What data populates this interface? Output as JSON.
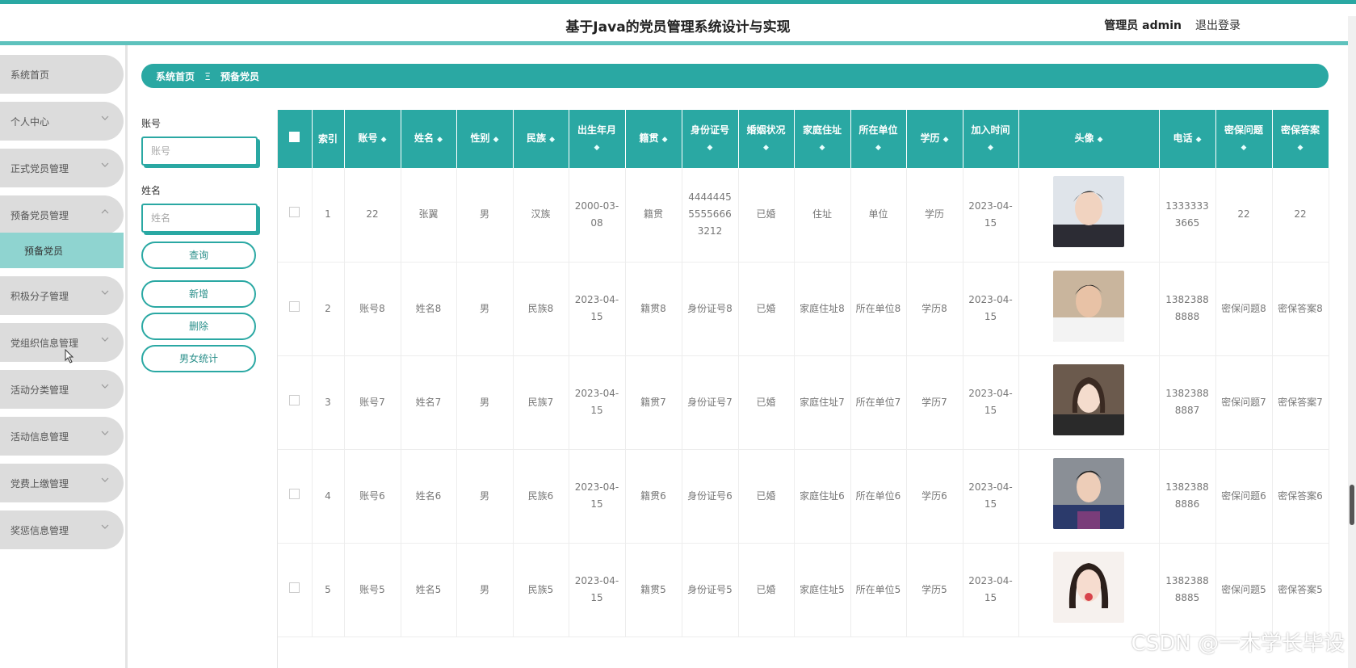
{
  "header": {
    "title": "基于Java的党员管理系统设计与实现",
    "admin": "管理员 admin",
    "logout": "退出登录"
  },
  "sidebar": {
    "items": [
      {
        "label": "系统首页",
        "has_chevron": false
      },
      {
        "label": "个人中心",
        "has_chevron": true
      },
      {
        "label": "正式党员管理",
        "has_chevron": true
      },
      {
        "label": "预备党员管理",
        "has_chevron": true
      },
      {
        "label": "积极分子管理",
        "has_chevron": true
      },
      {
        "label": "党组织信息管理",
        "has_chevron": true
      },
      {
        "label": "活动分类管理",
        "has_chevron": true
      },
      {
        "label": "活动信息管理",
        "has_chevron": true
      },
      {
        "label": "党费上缴管理",
        "has_chevron": true
      },
      {
        "label": "奖惩信息管理",
        "has_chevron": true
      }
    ],
    "submenu": {
      "label": "预备党员"
    }
  },
  "breadcrumb": {
    "home": "系统首页",
    "separator": "Ξ",
    "current": "预备党员"
  },
  "search": {
    "account_label": "账号",
    "account_placeholder": "账号",
    "name_label": "姓名",
    "name_placeholder": "姓名"
  },
  "buttons": {
    "query": "查询",
    "add": "新增",
    "delete": "删除",
    "stats": "男女统计"
  },
  "table": {
    "headers": [
      "索引",
      "账号",
      "姓名",
      "性别",
      "民族",
      "出生年月",
      "籍贯",
      "身份证号",
      "婚姻状况",
      "家庭住址",
      "所在单位",
      "学历",
      "加入时间",
      "头像",
      "电话",
      "密保问题",
      "密保答案"
    ],
    "rows": [
      {
        "index": "1",
        "account": "22",
        "name": "张翼",
        "gender": "男",
        "ethnicity": "汉族",
        "birth": "2000-03-08",
        "native": "籍贯",
        "id_card": "444444555556663212",
        "marital": "已婚",
        "address": "住址",
        "unit": "单位",
        "education": "学历",
        "join_time": "2023-04-15",
        "phone": "13333333665",
        "question": "22",
        "answer": "22"
      },
      {
        "index": "2",
        "account": "账号8",
        "name": "姓名8",
        "gender": "男",
        "ethnicity": "民族8",
        "birth": "2023-04-15",
        "native": "籍贯8",
        "id_card": "身份证号8",
        "marital": "已婚",
        "address": "家庭住址8",
        "unit": "所在单位8",
        "education": "学历8",
        "join_time": "2023-04-15",
        "phone": "13823888888",
        "question": "密保问题8",
        "answer": "密保答案8"
      },
      {
        "index": "3",
        "account": "账号7",
        "name": "姓名7",
        "gender": "男",
        "ethnicity": "民族7",
        "birth": "2023-04-15",
        "native": "籍贯7",
        "id_card": "身份证号7",
        "marital": "已婚",
        "address": "家庭住址7",
        "unit": "所在单位7",
        "education": "学历7",
        "join_time": "2023-04-15",
        "phone": "13823888887",
        "question": "密保问题7",
        "answer": "密保答案7"
      },
      {
        "index": "4",
        "account": "账号6",
        "name": "姓名6",
        "gender": "男",
        "ethnicity": "民族6",
        "birth": "2023-04-15",
        "native": "籍贯6",
        "id_card": "身份证号6",
        "marital": "已婚",
        "address": "家庭住址6",
        "unit": "所在单位6",
        "education": "学历6",
        "join_time": "2023-04-15",
        "phone": "13823888886",
        "question": "密保问题6",
        "answer": "密保答案6"
      },
      {
        "index": "5",
        "account": "账号5",
        "name": "姓名5",
        "gender": "男",
        "ethnicity": "民族5",
        "birth": "2023-04-15",
        "native": "籍贯5",
        "id_card": "身份证号5",
        "marital": "已婚",
        "address": "家庭住址5",
        "unit": "所在单位5",
        "education": "学历5",
        "join_time": "2023-04-15",
        "phone": "13823888885",
        "question": "密保问题5",
        "answer": "密保答案5"
      }
    ]
  },
  "watermark": "CSDN @一木学长毕设",
  "colors": {
    "accent": "#2aa8a3",
    "submenu_active": "#8fd4d0",
    "menu_bg": "#dcdcdc"
  },
  "icons": {
    "chevron": "chevron-down-icon",
    "chevron_open": "chevron-up-icon",
    "sort": "sort-icon"
  }
}
